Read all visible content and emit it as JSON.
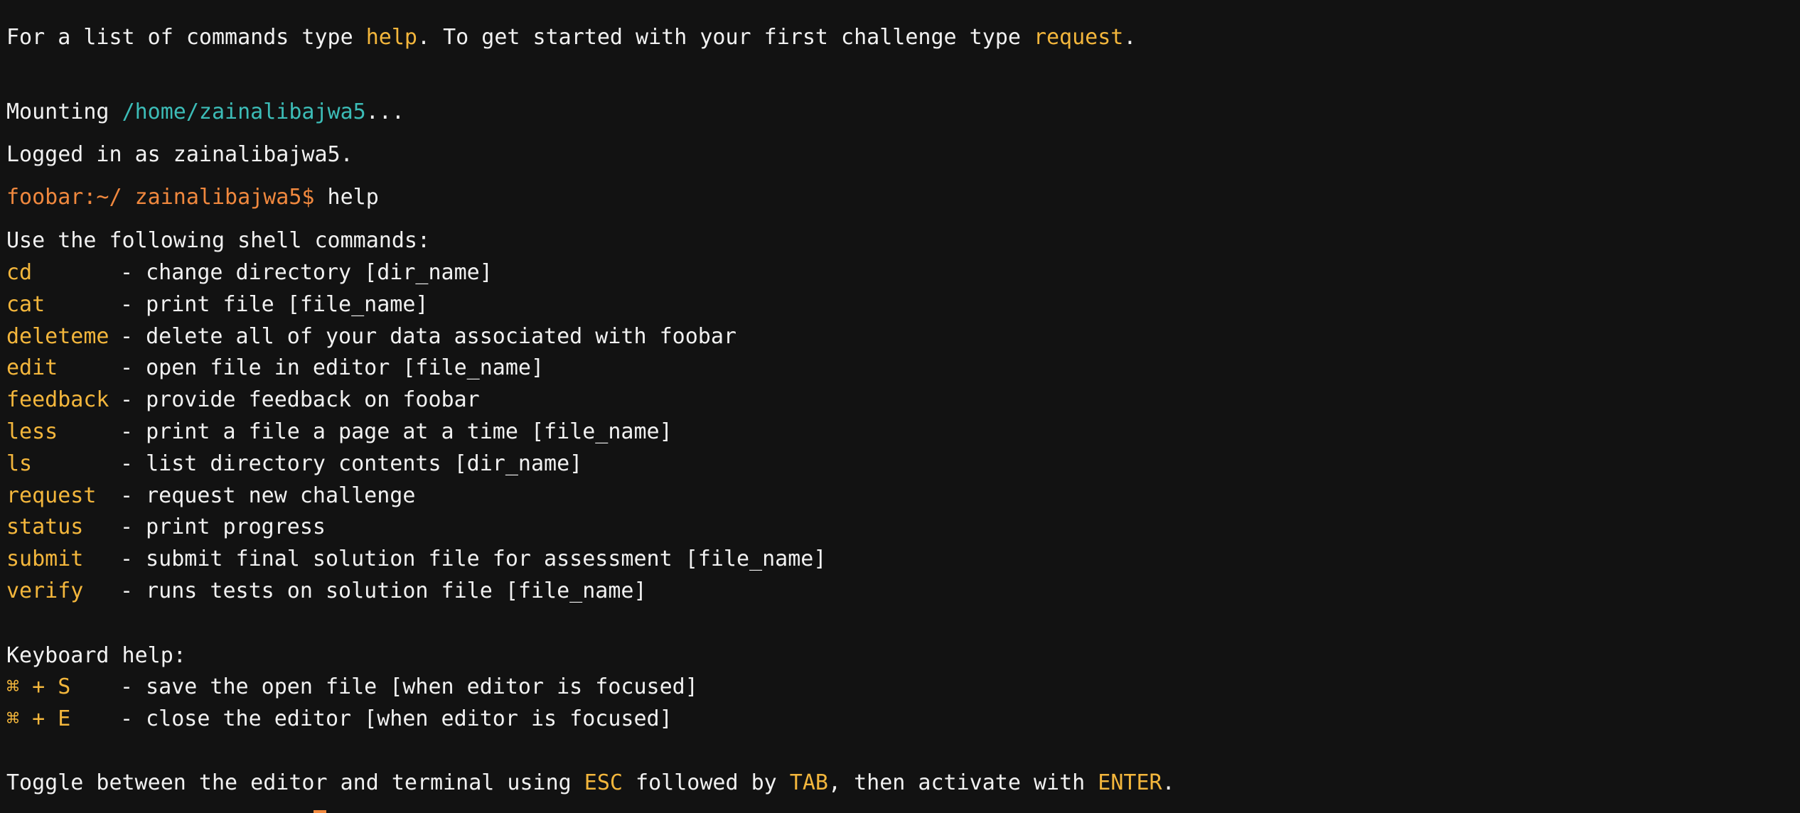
{
  "intro": {
    "part1": "For a list of commands type ",
    "help_cmd": "help",
    "part2": ". To get started with your first challenge type ",
    "request_cmd": "request",
    "part3": "."
  },
  "mount": {
    "prefix": "Mounting ",
    "path": "/home/zainalibajwa5",
    "suffix": "..."
  },
  "login": "Logged in as zainalibajwa5.",
  "prompt": {
    "text": "foobar:~/ zainalibajwa5$",
    "input": " help"
  },
  "shell_header": "Use the following shell commands:",
  "commands": [
    {
      "name": "cd",
      "desc": "- change directory [dir_name]"
    },
    {
      "name": "cat",
      "desc": "- print file [file_name]"
    },
    {
      "name": "deleteme",
      "desc": "- delete all of your data associated with foobar"
    },
    {
      "name": "edit",
      "desc": "- open file in editor [file_name]"
    },
    {
      "name": "feedback",
      "desc": "- provide feedback on foobar"
    },
    {
      "name": "less",
      "desc": "- print a file a page at a time [file_name]"
    },
    {
      "name": "ls",
      "desc": "- list directory contents [dir_name]"
    },
    {
      "name": "request",
      "desc": "- request new challenge"
    },
    {
      "name": "status",
      "desc": "- print progress"
    },
    {
      "name": "submit",
      "desc": "- submit final solution file for assessment [file_name]"
    },
    {
      "name": "verify",
      "desc": "- runs tests on solution file [file_name]"
    }
  ],
  "keyboard_header": "Keyboard help:",
  "keys": [
    {
      "name": "⌘ + S",
      "desc": "- save the open file [when editor is focused]"
    },
    {
      "name": "⌘ + E",
      "desc": "- close the editor [when editor is focused]"
    }
  ],
  "toggle": {
    "part1": "Toggle between the editor and terminal using ",
    "esc": "ESC",
    "part2": " followed by ",
    "tab": "TAB",
    "part3": ", then activate with ",
    "enter": "ENTER",
    "part4": "."
  },
  "colors": {
    "background": "#121212",
    "text": "#f1f1f1",
    "command": "#f3b63c",
    "prompt": "#f0883e",
    "path": "#3cbcb7"
  }
}
